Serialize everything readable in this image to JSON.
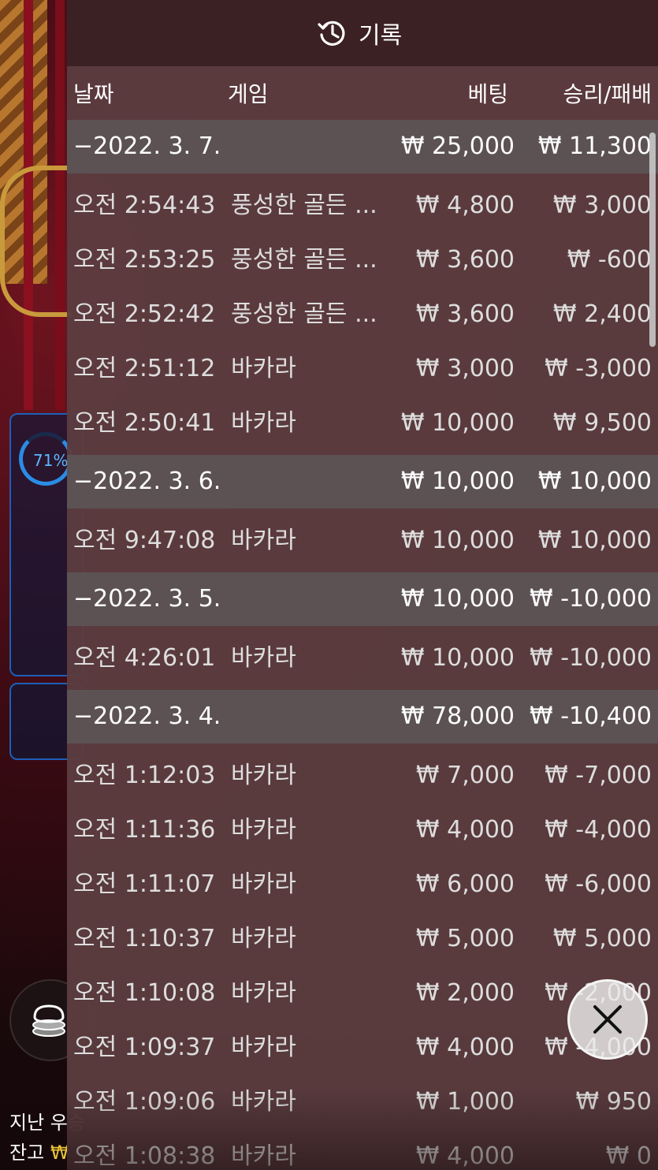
{
  "header": {
    "title": "기록",
    "icon": "history-icon"
  },
  "columns": {
    "date": "날짜",
    "game": "게임",
    "bet": "베팅",
    "winloss": "승리/패배"
  },
  "groups": [
    {
      "date": "−2022. 3. 7.",
      "bet": "₩ 25,000",
      "winloss": "₩ 11,300",
      "rows": [
        {
          "time": "오전 2:54:43",
          "game": "풍성한 골든 ...",
          "bet": "₩ 4,800",
          "winloss": "₩ 3,000"
        },
        {
          "time": "오전 2:53:25",
          "game": "풍성한 골든 ...",
          "bet": "₩ 3,600",
          "winloss": "₩ -600"
        },
        {
          "time": "오전 2:52:42",
          "game": "풍성한 골든 ...",
          "bet": "₩ 3,600",
          "winloss": "₩ 2,400"
        },
        {
          "time": "오전 2:51:12",
          "game": "바카라",
          "bet": "₩ 3,000",
          "winloss": "₩ -3,000"
        },
        {
          "time": "오전 2:50:41",
          "game": "바카라",
          "bet": "₩ 10,000",
          "winloss": "₩ 9,500"
        }
      ]
    },
    {
      "date": "−2022. 3. 6.",
      "bet": "₩ 10,000",
      "winloss": "₩ 10,000",
      "rows": [
        {
          "time": "오전 9:47:08",
          "game": "바카라",
          "bet": "₩ 10,000",
          "winloss": "₩ 10,000"
        }
      ]
    },
    {
      "date": "−2022. 3. 5.",
      "bet": "₩ 10,000",
      "winloss": "₩ -10,000",
      "rows": [
        {
          "time": "오전 4:26:01",
          "game": "바카라",
          "bet": "₩ 10,000",
          "winloss": "₩ -10,000"
        }
      ]
    },
    {
      "date": "−2022. 3. 4.",
      "bet": "₩ 78,000",
      "winloss": "₩ -10,400",
      "rows": [
        {
          "time": "오전 1:12:03",
          "game": "바카라",
          "bet": "₩ 7,000",
          "winloss": "₩ -7,000"
        },
        {
          "time": "오전 1:11:36",
          "game": "바카라",
          "bet": "₩ 4,000",
          "winloss": "₩ -4,000"
        },
        {
          "time": "오전 1:11:07",
          "game": "바카라",
          "bet": "₩ 6,000",
          "winloss": "₩ -6,000"
        },
        {
          "time": "오전 1:10:37",
          "game": "바카라",
          "bet": "₩ 5,000",
          "winloss": "₩ 5,000"
        },
        {
          "time": "오전 1:10:08",
          "game": "바카라",
          "bet": "₩ 2,000",
          "winloss": "₩ -2,000"
        },
        {
          "time": "오전 1:09:37",
          "game": "바카라",
          "bet": "₩ 4,000",
          "winloss": "₩ -4,000"
        },
        {
          "time": "오전 1:09:06",
          "game": "바카라",
          "bet": "₩ 1,000",
          "winloss": "₩ 950"
        },
        {
          "time": "오전 1:08:38",
          "game": "바카라",
          "bet": "₩ 4,000",
          "winloss": "₩ 0"
        }
      ]
    }
  ],
  "background": {
    "progress_text": "71%",
    "progress_value": 0.71,
    "last_win_label": "지난 우승",
    "balance_label": "잔고",
    "balance_currency": "₩"
  },
  "close_icon": "close-icon"
}
